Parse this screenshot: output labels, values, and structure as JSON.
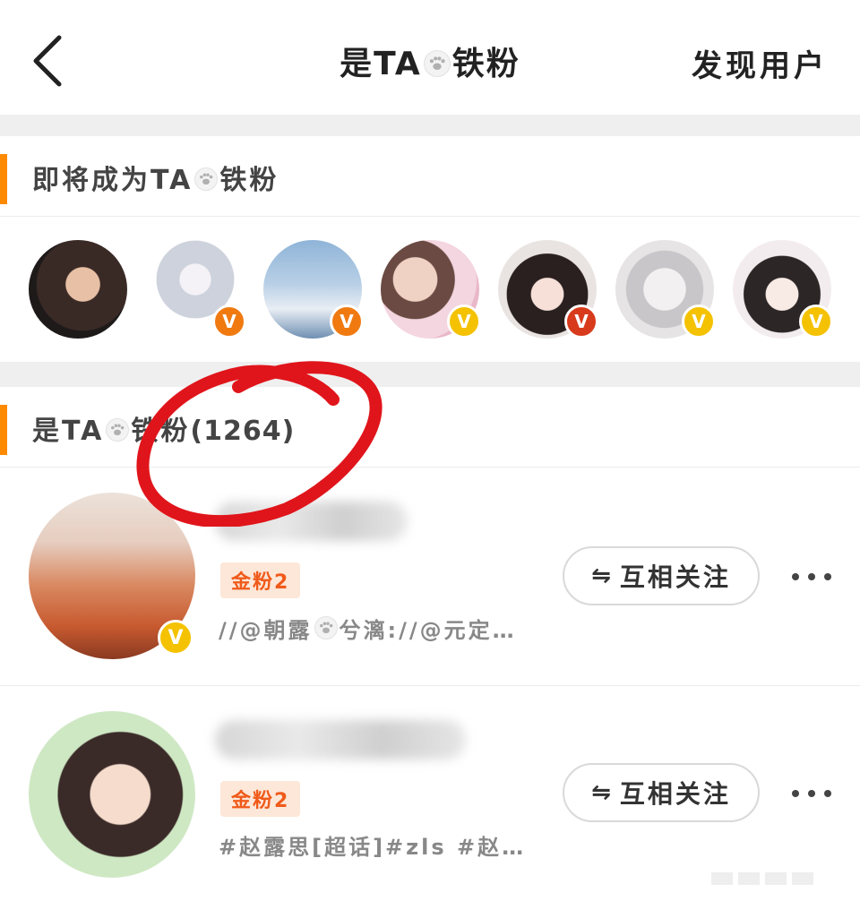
{
  "header": {
    "title_prefix": "是TA",
    "title_suffix": "铁粉",
    "discover_label": "发现用户"
  },
  "upcoming_section": {
    "title_prefix": "即将成为TA",
    "title_suffix": "铁粉"
  },
  "upcoming_avatars": [
    {
      "badge": "",
      "badge_color": ""
    },
    {
      "badge": "V",
      "badge_color": "orange"
    },
    {
      "badge": "V",
      "badge_color": "orange"
    },
    {
      "badge": "V",
      "badge_color": "gold"
    },
    {
      "badge": "V",
      "badge_color": "red"
    },
    {
      "badge": "V",
      "badge_color": "gold"
    },
    {
      "badge": "V",
      "badge_color": "gold"
    }
  ],
  "fans_section": {
    "title_prefix": "是TA",
    "title_suffix": "铁粉",
    "count": "(1264)"
  },
  "fans": [
    {
      "badge": "金粉2",
      "desc_prefix": "//@朝露",
      "desc_suffix": "兮漓://@元定…",
      "button_label": "互相关注",
      "button_icon": "⇋"
    },
    {
      "badge": "金粉2",
      "desc_prefix": "#赵露思[超话]#zls #赵…",
      "desc_suffix": "",
      "button_label": "互相关注",
      "button_icon": "⇋"
    }
  ],
  "colors": {
    "accent": "#ff8a00",
    "fan_badge_bg": "#fde7d8",
    "fan_badge_text": "#f05a1a",
    "verified_gold": "#f4c200",
    "verified_orange": "#f07a10",
    "verified_red": "#d83a1c",
    "annotation_red": "#e0151b"
  }
}
